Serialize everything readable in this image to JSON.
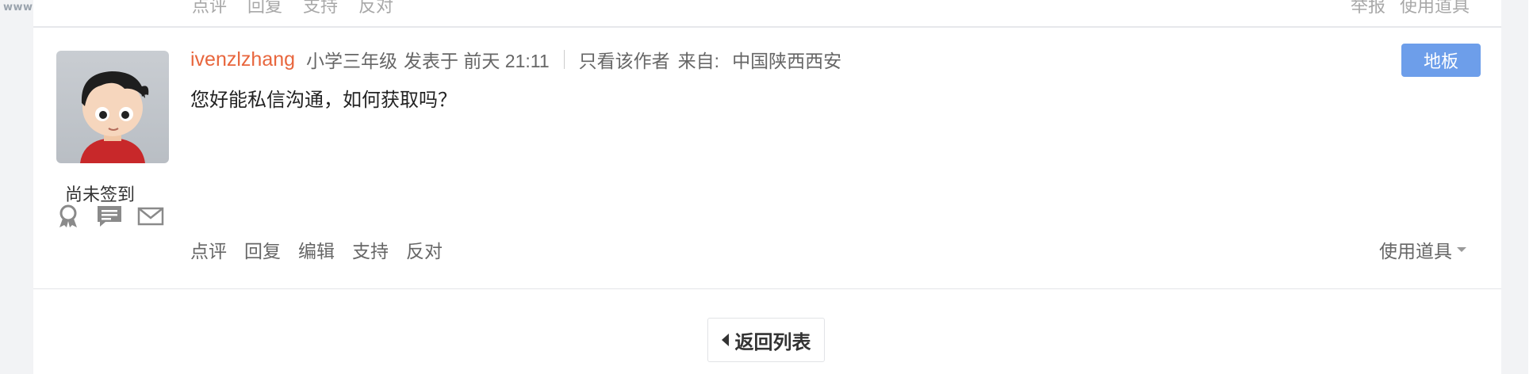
{
  "watermark": "www.yuaigongwu.com",
  "previous_post": {
    "actions": [
      "点评",
      "回复",
      "支持",
      "反对"
    ],
    "report": "举报",
    "tools": "使用道具"
  },
  "post": {
    "username": "ivenzlzhang",
    "grade": "小学三年级",
    "posted_label": "发表于",
    "posted_time": "前天 21:11",
    "only_author": "只看该作者",
    "from_label": "来自:",
    "location": "中国陕西西安",
    "floor": "地板",
    "content": "您好能私信沟通，如何获取吗？",
    "actions": [
      "点评",
      "回复",
      "编辑",
      "支持",
      "反对"
    ],
    "tools": "使用道具"
  },
  "user_panel": {
    "sign_status": "尚未签到",
    "icons": [
      "medal-icon",
      "posts-icon",
      "message-icon"
    ]
  },
  "back_button": "返回列表",
  "colors": {
    "username": "#e8663d",
    "floor_button": "#6d9eea"
  }
}
